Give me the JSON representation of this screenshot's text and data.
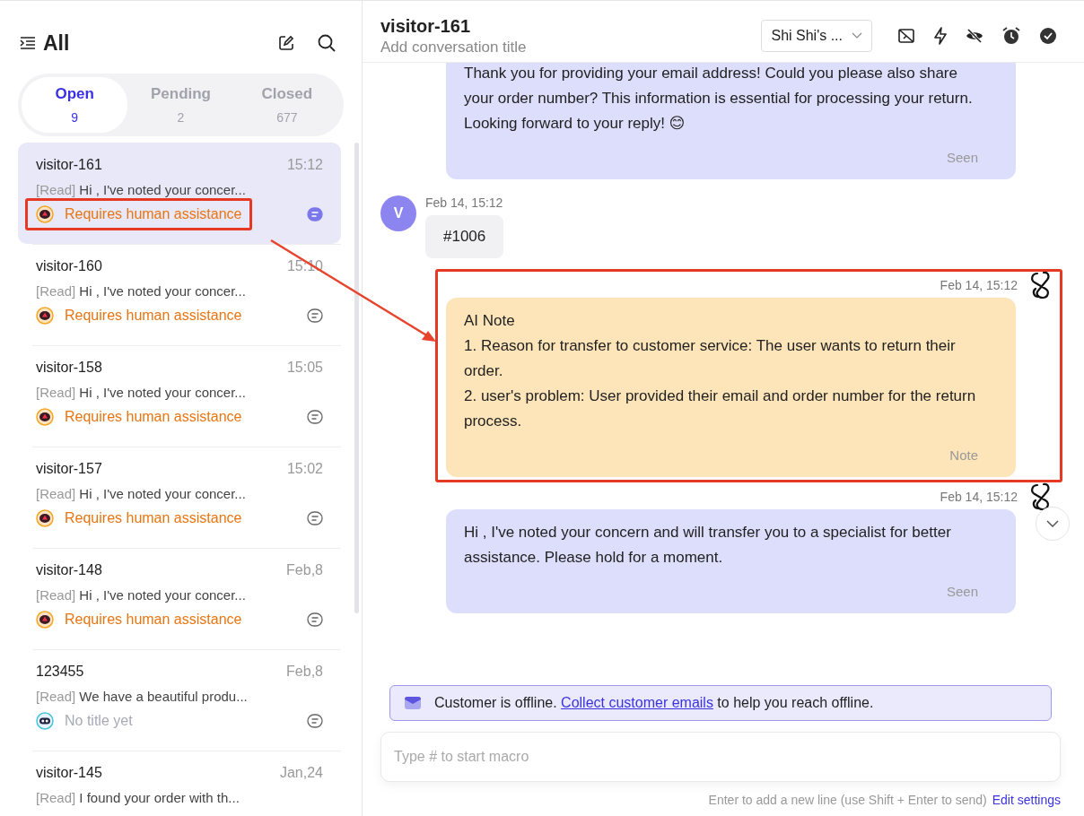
{
  "sidebar": {
    "title": "All",
    "tabs": [
      {
        "label": "Open",
        "count": "9",
        "selected": true
      },
      {
        "label": "Pending",
        "count": "2",
        "selected": false
      },
      {
        "label": "Closed",
        "count": "677",
        "selected": false
      }
    ],
    "conversations": [
      {
        "name": "visitor-161",
        "time": "15:12",
        "read_tag": "[Read]",
        "preview": "Hi , I've noted your concer...",
        "label": {
          "kind": "alert",
          "text": "Requires human assistance",
          "annotated": true
        },
        "unread": true,
        "selected": true
      },
      {
        "name": "visitor-160",
        "time": "15:10",
        "read_tag": "[Read]",
        "preview": "Hi , I've noted your concer...",
        "label": {
          "kind": "alert",
          "text": "Requires human assistance",
          "annotated": false
        },
        "unread": false,
        "selected": false
      },
      {
        "name": "visitor-158",
        "time": "15:05",
        "read_tag": "[Read]",
        "preview": "Hi , I've noted your concer...",
        "label": {
          "kind": "alert",
          "text": "Requires human assistance",
          "annotated": false
        },
        "unread": false,
        "selected": false
      },
      {
        "name": "visitor-157",
        "time": "15:02",
        "read_tag": "[Read]",
        "preview": "Hi , I've noted your concer...",
        "label": {
          "kind": "alert",
          "text": "Requires human assistance",
          "annotated": false
        },
        "unread": false,
        "selected": false
      },
      {
        "name": "visitor-148",
        "time": "Feb,8",
        "read_tag": "[Read]",
        "preview": "Hi , I've noted your concer...",
        "label": {
          "kind": "alert",
          "text": "Requires human assistance",
          "annotated": false
        },
        "unread": false,
        "selected": false
      },
      {
        "name": "123455",
        "time": "Feb,8",
        "read_tag": "[Read]",
        "preview": "We have a beautiful produ...",
        "label": {
          "kind": "bot",
          "text": "No title yet",
          "annotated": false
        },
        "unread": false,
        "selected": false
      },
      {
        "name": "visitor-145",
        "time": "Jan,24",
        "read_tag": "[Read]",
        "preview": "I found your order with th...",
        "selected": false
      }
    ]
  },
  "chat": {
    "title": "visitor-161",
    "subtitle": "Add conversation title",
    "assignee": "Shi Shi's ...",
    "messages": [
      {
        "kind": "agent",
        "lines": [
          "Thank you for providing your email address! Could you please also share your order number? This information is essential for processing your return. Looking forward to your reply! 😊"
        ],
        "status": "Seen",
        "annotated": false
      },
      {
        "kind": "visitor",
        "avatar": "V",
        "time": "Feb 14, 15:12",
        "lines": [
          "#1006"
        ],
        "annotated": false
      },
      {
        "kind": "note",
        "time": "Feb 14, 15:12",
        "lines": [
          "AI Note",
          "1. Reason for transfer to customer service: The user wants to return their order.",
          "2. user's problem: User provided their email and order number for the return process."
        ],
        "status": "Note",
        "annotated": true
      },
      {
        "kind": "agent",
        "time": "Feb 14, 15:12",
        "lines": [
          "Hi , I've noted your concern and will transfer you to a specialist for better assistance. Please hold for a moment."
        ],
        "status": "Seen",
        "annotated": false
      }
    ],
    "banner": {
      "before": "Customer is offline.",
      "link": "Collect customer emails",
      "after": "to help you reach offline."
    },
    "input": {
      "placeholder": "Type # to start macro"
    },
    "hint": "Enter to add a new line (use Shift + Enter to send)",
    "hint_link": "Edit settings"
  }
}
